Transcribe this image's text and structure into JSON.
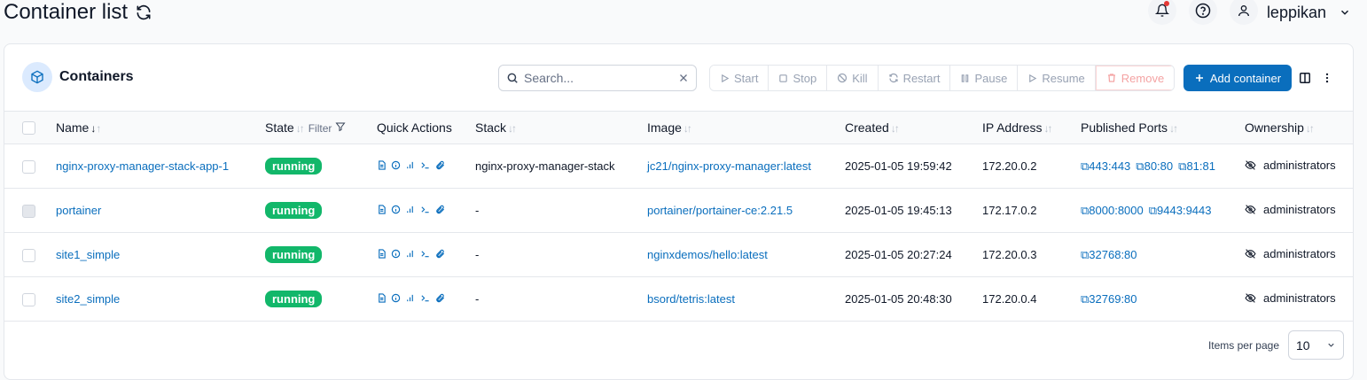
{
  "page": {
    "title": "Container list"
  },
  "user": {
    "name": "leppikan"
  },
  "card": {
    "title": "Containers"
  },
  "search": {
    "placeholder": "Search..."
  },
  "actions": {
    "start": "Start",
    "stop": "Stop",
    "kill": "Kill",
    "restart": "Restart",
    "pause": "Pause",
    "resume": "Resume",
    "remove": "Remove",
    "add": "Add container"
  },
  "columns": {
    "name": "Name",
    "state": "State",
    "filter": "Filter",
    "quick_actions": "Quick Actions",
    "stack": "Stack",
    "image": "Image",
    "created": "Created",
    "ip": "IP Address",
    "ports": "Published Ports",
    "ownership": "Ownership"
  },
  "rows": [
    {
      "name": "nginx-proxy-manager-stack-app-1",
      "state": "running",
      "stack": "nginx-proxy-manager-stack",
      "image": "jc21/nginx-proxy-manager:latest",
      "created": "2025-01-05 19:59:42",
      "ip": "172.20.0.2",
      "ports": [
        "443:443",
        "80:80",
        "81:81"
      ],
      "ownership": "administrators"
    },
    {
      "name": "portainer",
      "state": "running",
      "stack": "-",
      "image": "portainer/portainer-ce:2.21.5",
      "created": "2025-01-05 19:45:13",
      "ip": "172.17.0.2",
      "ports": [
        "8000:8000",
        "9443:9443"
      ],
      "ownership": "administrators"
    },
    {
      "name": "site1_simple",
      "state": "running",
      "stack": "-",
      "image": "nginxdemos/hello:latest",
      "created": "2025-01-05 20:27:24",
      "ip": "172.20.0.3",
      "ports": [
        "32768:80"
      ],
      "ownership": "administrators"
    },
    {
      "name": "site2_simple",
      "state": "running",
      "stack": "-",
      "image": "bsord/tetris:latest",
      "created": "2025-01-05 20:48:30",
      "ip": "172.20.0.4",
      "ports": [
        "32769:80"
      ],
      "ownership": "administrators"
    }
  ],
  "footer": {
    "items_per_page_label": "Items per page",
    "items_per_page": "10"
  },
  "colors": {
    "accent": "#0a6ebd",
    "running": "#12b76a"
  }
}
